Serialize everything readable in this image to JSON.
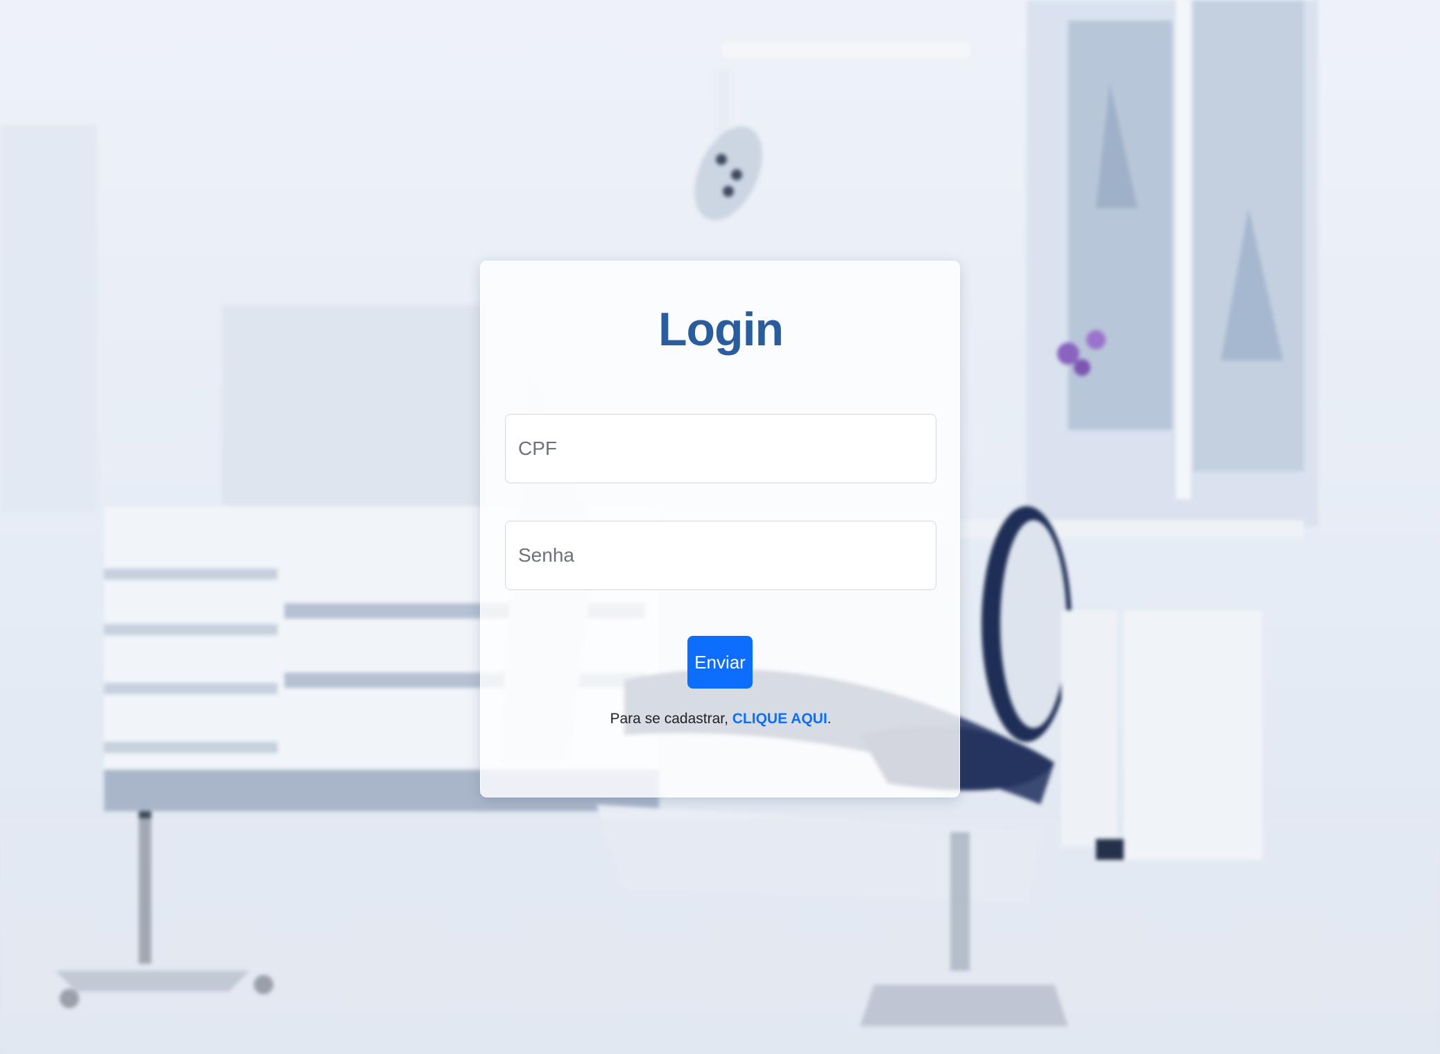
{
  "login": {
    "title": "Login",
    "cpf_placeholder": "CPF",
    "senha_placeholder": "Senha",
    "submit_label": "Enviar",
    "register_prefix": "Para se cadastrar, ",
    "register_link": "CLIQUE AQUI",
    "register_suffix": "."
  },
  "colors": {
    "title": "#2a5d9e",
    "button": "#0d6efd",
    "link": "#0d6efd"
  }
}
